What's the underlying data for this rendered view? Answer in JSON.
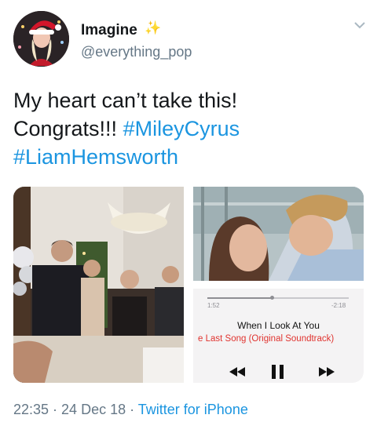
{
  "tweet": {
    "display_name": "Imagine",
    "handle": "@everything_pop",
    "text_line1": "My heart can’t take this!",
    "text_line2_plain": "Congrats!!! ",
    "hashtag1": "#MileyCyrus",
    "hashtag2": "#LiamHemsworth",
    "time": "22:35",
    "separator": " · ",
    "date": "24 Dec 18",
    "source": "Twitter for iPhone"
  },
  "music_player": {
    "elapsed": "1:52",
    "remaining": "-2:18",
    "progress_fraction": 0.46,
    "song_title": "When I Look At You",
    "album": "e Last Song (Original Soundtrack)"
  },
  "icons": {
    "verified_sparkle": "sparkle-icon",
    "more": "chevron-down-icon",
    "rewind": "rewind-icon",
    "pause": "pause-icon",
    "forward": "fast-forward-icon"
  },
  "colors": {
    "link": "#1b95e0",
    "secondary_text": "#657786",
    "album_red": "#e0332f"
  }
}
